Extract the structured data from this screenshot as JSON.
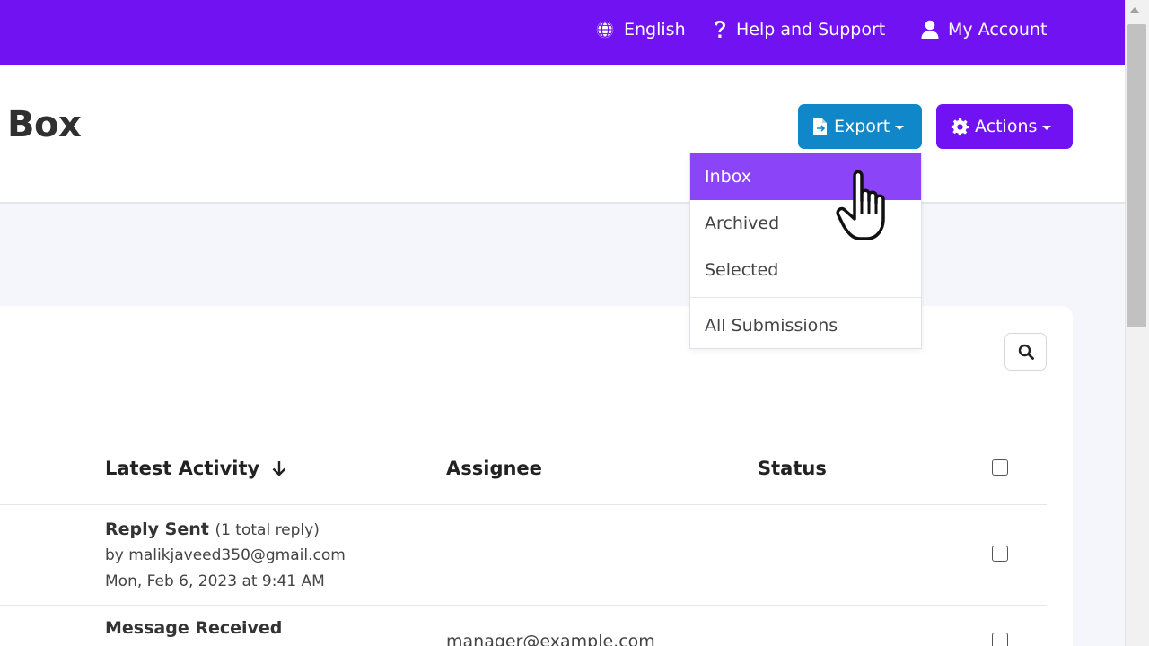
{
  "topbar": {
    "language_label": "English",
    "help_label": "Help and Support",
    "account_label": "My Account"
  },
  "header": {
    "title": "Box",
    "export_label": "Export",
    "actions_label": "Actions"
  },
  "export_menu": {
    "items": [
      "Inbox",
      "Archived",
      "Selected",
      "All Submissions"
    ],
    "active_item": "Inbox"
  },
  "table": {
    "columns": [
      "Latest Activity",
      "Assignee",
      "Status"
    ],
    "sort_column": "Latest Activity",
    "rows": [
      {
        "activity": "Reply Sent",
        "detail": "(1 total reply)",
        "by": "by malikjaveed350@gmail.com",
        "date": "Mon, Feb 6, 2023 at 9:41 AM",
        "assignee": "",
        "status": ""
      },
      {
        "activity": "Message Received",
        "detail": "",
        "by": "",
        "date": "",
        "assignee": "manager@example.com",
        "status": ""
      }
    ]
  },
  "colors": {
    "brand_purple": "#7012f2",
    "export_blue": "#0f87c8",
    "menu_active": "#8b44f7"
  },
  "icons": [
    "globe-icon",
    "question-icon",
    "user-icon",
    "file-export-icon",
    "gear-icon",
    "search-icon",
    "sort-arrow-down-icon",
    "hand-pointer-cursor"
  ]
}
